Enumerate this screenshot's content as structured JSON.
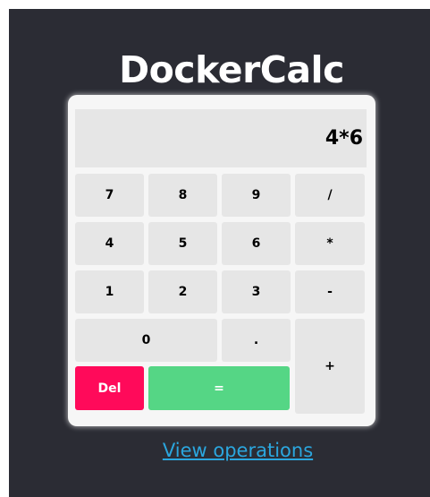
{
  "app": {
    "title": "DockerCalc"
  },
  "display": {
    "value": "4*6"
  },
  "keys": {
    "k7": "7",
    "k8": "8",
    "k9": "9",
    "div": "/",
    "k4": "4",
    "k5": "5",
    "k6": "6",
    "mul": "*",
    "k1": "1",
    "k2": "2",
    "k3": "3",
    "sub": "-",
    "k0": "0",
    "dot": ".",
    "add": "+",
    "del": "Del",
    "eq": "="
  },
  "footer": {
    "link_label": "View operations"
  },
  "colors": {
    "background": "#2b2c34",
    "panel": "#f6f6f6",
    "key": "#e6e6e6",
    "delete": "#ff0a5a",
    "equals": "#55d685",
    "link": "#2ba6de"
  }
}
